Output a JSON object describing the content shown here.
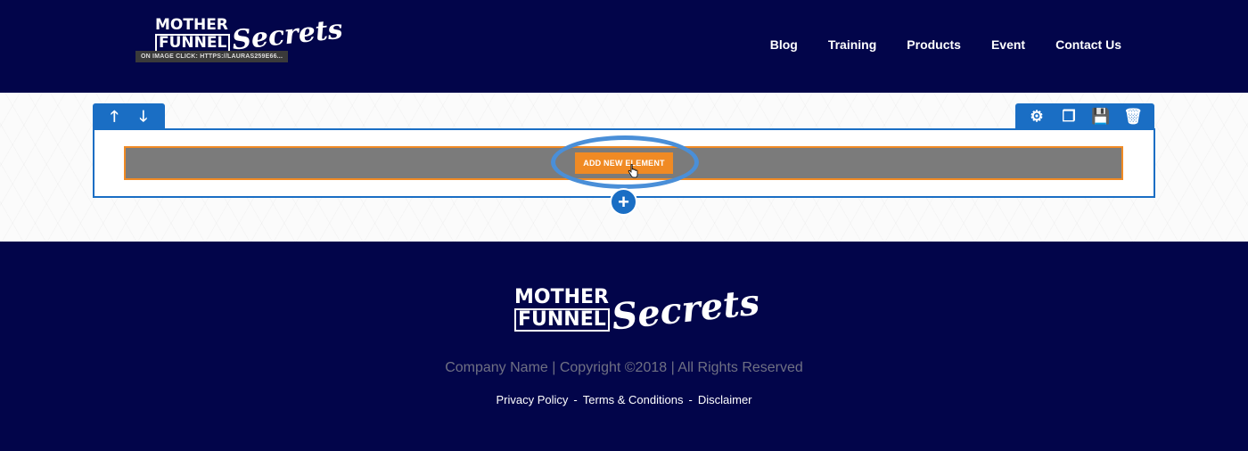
{
  "header": {
    "logo": {
      "line1": "MOTHER",
      "line2": "FUNNEL",
      "script": "Secrets"
    },
    "image_link_tag": "ON IMAGE CLICK: HTTPS://LAURAS259E66...",
    "nav": [
      {
        "label": "Blog"
      },
      {
        "label": "Training"
      },
      {
        "label": "Products"
      },
      {
        "label": "Event"
      },
      {
        "label": "Contact Us"
      }
    ]
  },
  "builder": {
    "row_toolbar_left": [
      {
        "icon": "arrow-up-icon",
        "glyph": "🡑"
      },
      {
        "icon": "arrow-down-icon",
        "glyph": "🡓"
      }
    ],
    "row_toolbar_right": [
      {
        "icon": "gear-icon",
        "glyph": "⚙"
      },
      {
        "icon": "copy-icon",
        "glyph": "❐"
      },
      {
        "icon": "save-icon",
        "glyph": "💾"
      },
      {
        "icon": "trash-icon",
        "glyph": "🗑"
      }
    ],
    "add_element_label": "ADD NEW ELEMENT",
    "add_row_glyph": "+"
  },
  "footer": {
    "logo": {
      "line1": "MOTHER",
      "line2": "FUNNEL",
      "script": "Secrets"
    },
    "copyright": "Company Name | Copyright ©2018 | All Rights Reserved",
    "links": [
      "Privacy Policy",
      "Terms & Conditions",
      "Disclaimer"
    ],
    "link_separator": "-"
  },
  "colors": {
    "navy": "#02054a",
    "builder_blue": "#1a6ec4",
    "orange": "#f08a24",
    "element_gray": "#7b7b7b",
    "highlight": "#4a8fd8"
  }
}
